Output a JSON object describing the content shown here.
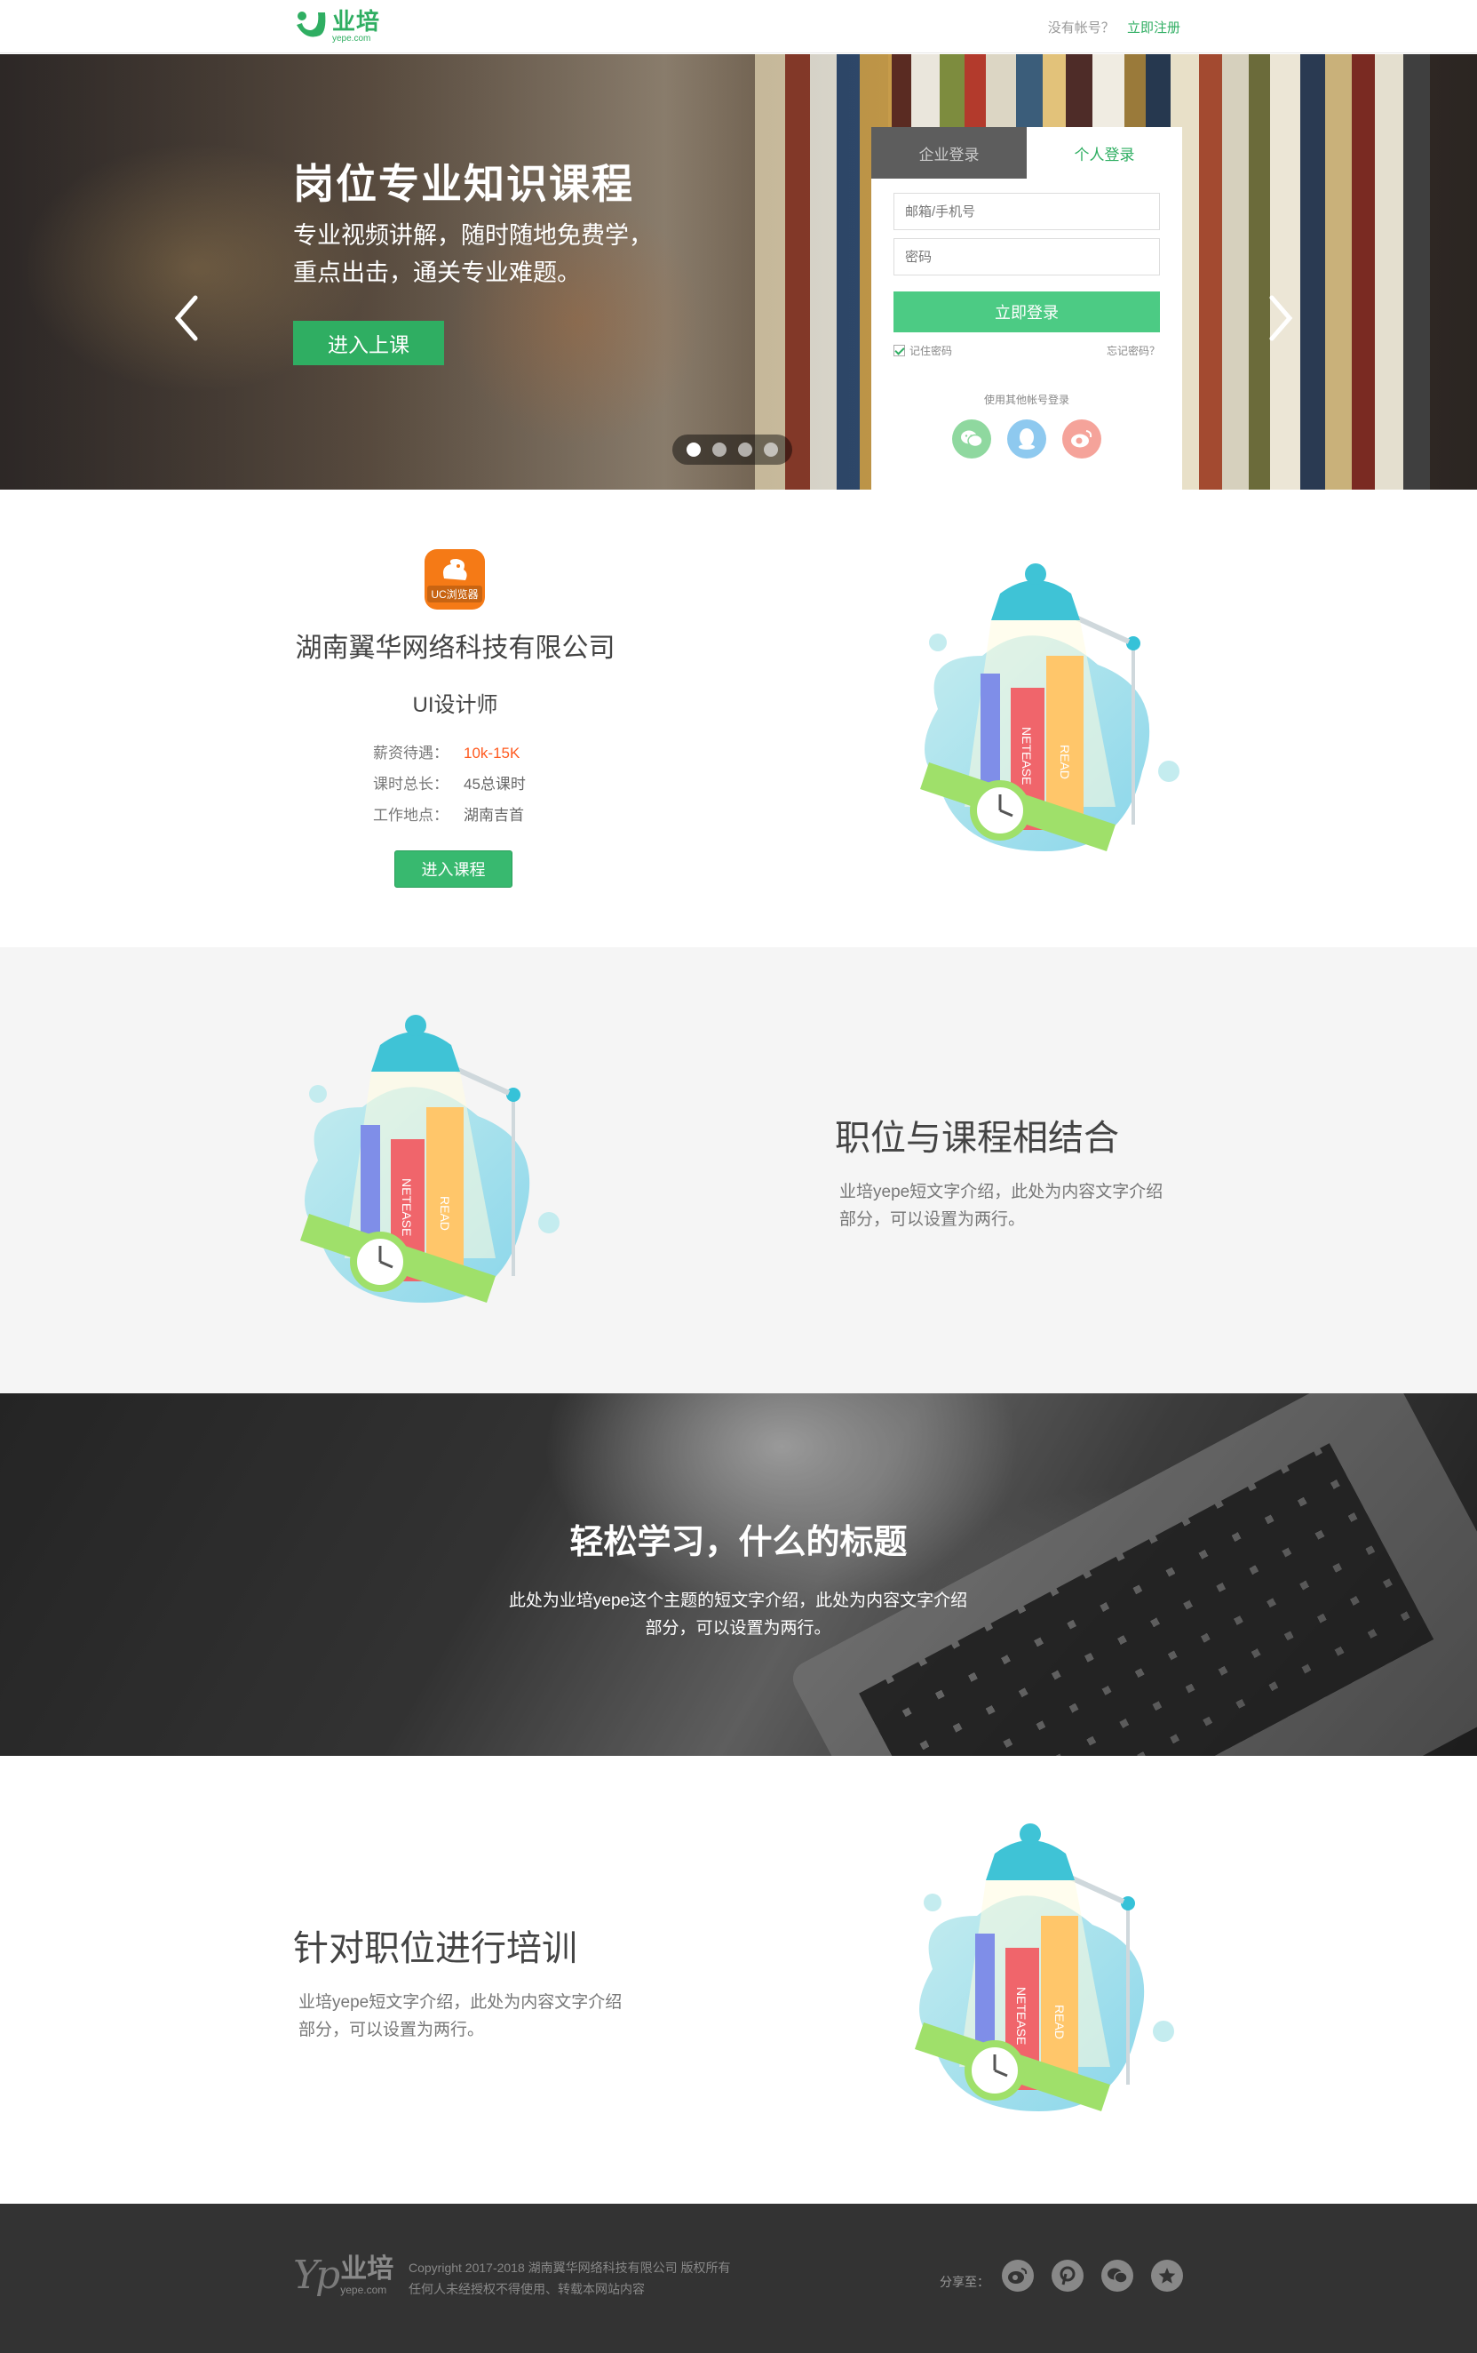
{
  "header": {
    "logo_cn": "业培",
    "logo_en": "yepe.com",
    "no_account": "没有帐号？",
    "register": "立即注册"
  },
  "hero": {
    "title": "岗位专业知识课程",
    "subtitle_line1": "专业视频讲解，随时随地免费学，",
    "subtitle_line2": "重点出击，通关专业难题。",
    "button": "进入上课",
    "slides": 4,
    "active_slide": 1
  },
  "login": {
    "tab_enterprise": "企业登录",
    "tab_personal": "个人登录",
    "account_placeholder": "邮箱/手机号",
    "password_placeholder": "密码",
    "submit": "立即登录",
    "remember": "记住密码",
    "forgot": "忘记密码？",
    "other_login": "使用其他帐号登录",
    "social_icons": [
      "wechat-icon",
      "qq-icon",
      "weibo-icon"
    ]
  },
  "job": {
    "company_logo_text": "UC浏览器",
    "company": "湖南翼华网络科技有限公司",
    "title": "UI设计师",
    "salary_label": "薪资待遇：",
    "salary": "10k-15K",
    "hours_label": "课时总长：",
    "hours": "45总课时",
    "location_label": "工作地点：",
    "location": "湖南吉首",
    "button": "进入课程"
  },
  "illustration": {
    "book1": "NETEASE",
    "book2": "READ"
  },
  "feature1": {
    "title": "职位与课程相结合",
    "desc_line1": "业培yepe短文字介绍，此处为内容文字介绍",
    "desc_line2": "部分，可以设置为两行。"
  },
  "banner": {
    "title": "轻松学习，什么的标题",
    "desc_line1": "此处为业培yepe这个主题的短文字介绍，此处为内容文字介绍",
    "desc_line2": "部分，可以设置为两行。"
  },
  "feature2": {
    "title": "针对职位进行培训",
    "desc_line1": "业培yepe短文字介绍，此处为内容文字介绍",
    "desc_line2": "部分，可以设置为两行。"
  },
  "footer": {
    "logo_mark": "Yp",
    "logo_cn": "业培",
    "logo_en": "yepe.com",
    "copyright": "Copyright  2017-2018  湖南翼华网络科技有限公司  版权所有",
    "notice": "任何人未经授权不得使用、转载本网站内容",
    "share_label": "分享至：",
    "share_icons": [
      "weibo-icon",
      "pinterest-icon",
      "wechat-icon",
      "favorite-icon"
    ]
  },
  "colors": {
    "brand_green": "#2fae62",
    "button_green": "#4ccb84",
    "salary_orange": "#ff5a1f",
    "footer_bg": "#333333"
  }
}
